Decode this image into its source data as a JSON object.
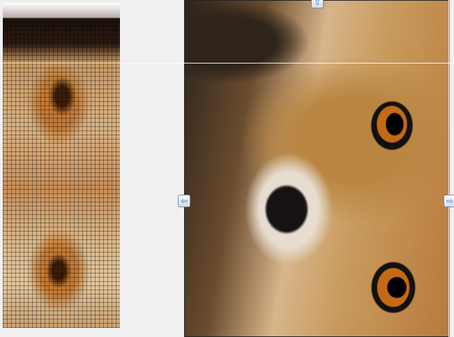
{
  "window": {
    "background": "#f0f0f0"
  },
  "mosaic_preview": {
    "header": "",
    "tile_style": "mosaic"
  },
  "image_view": {
    "subject": ""
  },
  "handles": {
    "top": {
      "icon": "arrow-up-icon",
      "glyph": "⇧",
      "color": "#1f6fd6"
    },
    "left": {
      "icon": "arrow-left-icon",
      "glyph": "⇦",
      "color": "#1f6fd6"
    },
    "right": {
      "icon": "arrow-right-icon",
      "glyph": "⇨",
      "color": "#1f6fd6"
    }
  }
}
